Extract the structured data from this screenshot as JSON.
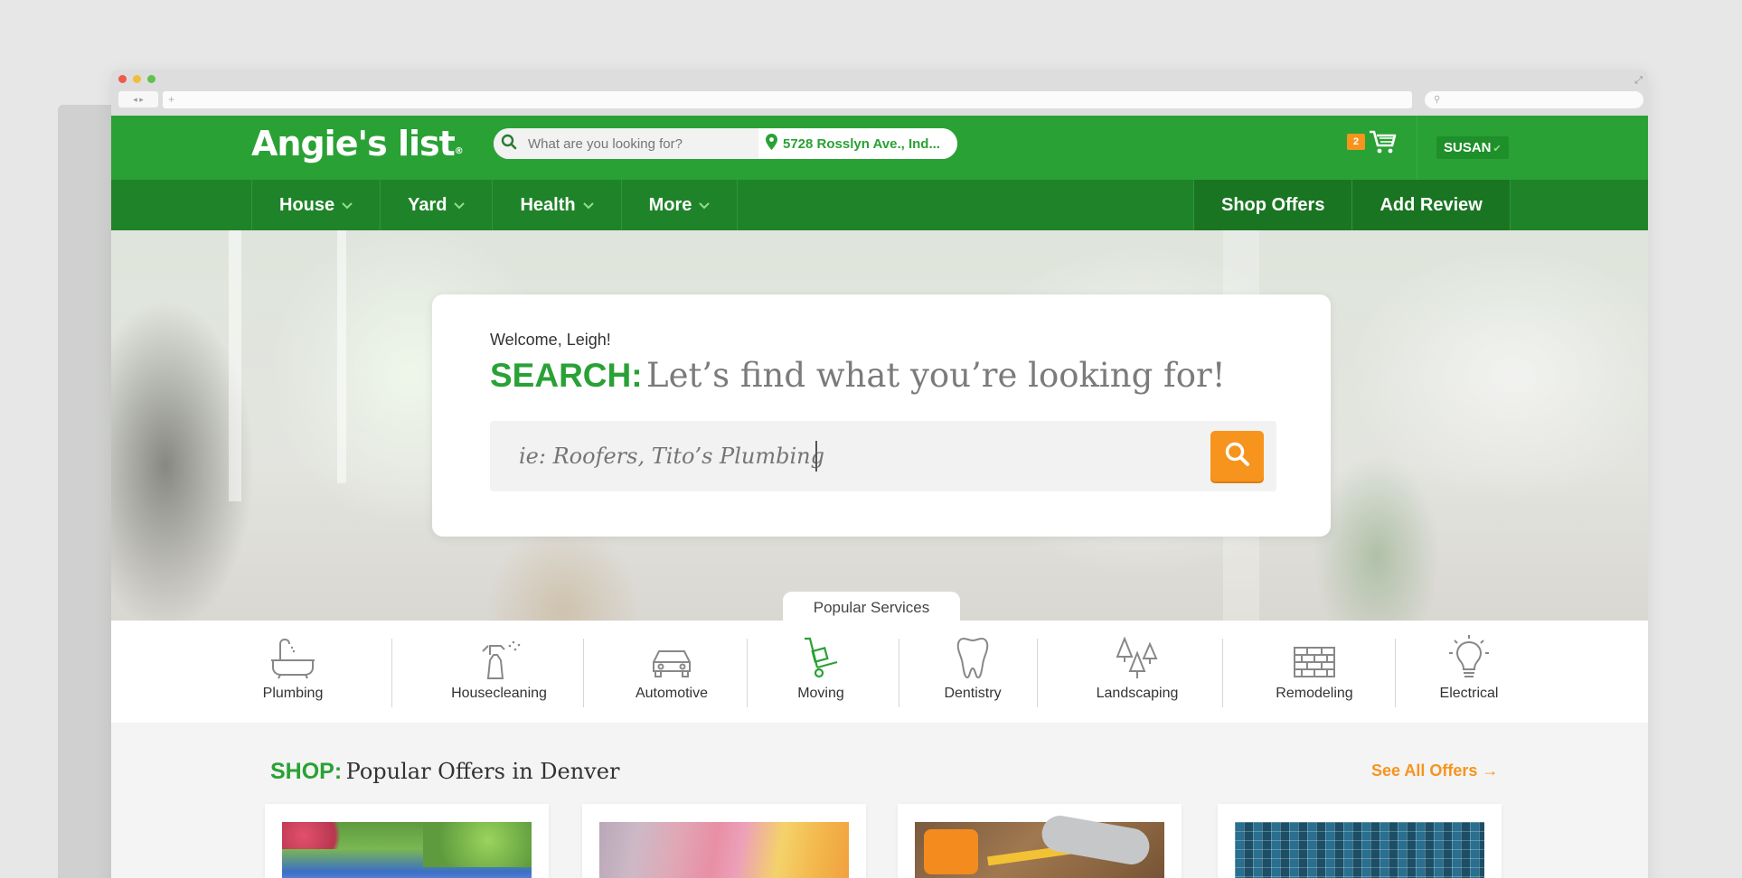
{
  "browser": {
    "nav_arrows": "◂ ▸",
    "url_placeholder": "+",
    "search_glyph": "⚲"
  },
  "header": {
    "logo_text": "Angie's list",
    "logo_mark": "®",
    "search_placeholder": "What are you looking for?",
    "location": "5728 Rosslyn Ave., Ind...",
    "cart_count": "2",
    "user_name": "SUSAN"
  },
  "nav": {
    "items": [
      {
        "label": "House"
      },
      {
        "label": "Yard"
      },
      {
        "label": "Health"
      },
      {
        "label": "More"
      }
    ],
    "shop_offers": "Shop Offers",
    "add_review": "Add Review"
  },
  "hero": {
    "welcome": "Welcome, Leigh!",
    "headline_accent": "SEARCH:",
    "headline_rest": "Let’s find what you’re looking for!",
    "search_placeholder": "ie: Roofers, Tito’s Plumbing"
  },
  "popular": {
    "tab_label": "Popular Services",
    "services": [
      {
        "label": "Plumbing",
        "icon": "bathtub-icon"
      },
      {
        "label": "Housecleaning",
        "icon": "spray-bottle-icon"
      },
      {
        "label": "Automotive",
        "icon": "car-icon"
      },
      {
        "label": "Moving",
        "icon": "hand-truck-icon"
      },
      {
        "label": "Dentistry",
        "icon": "tooth-icon"
      },
      {
        "label": "Landscaping",
        "icon": "trees-icon"
      },
      {
        "label": "Remodeling",
        "icon": "bricks-icon"
      },
      {
        "label": "Electrical",
        "icon": "lightbulb-icon"
      }
    ]
  },
  "shop": {
    "title_accent": "SHOP:",
    "title_rest": "Popular Offers in Denver",
    "see_all": "See All Offers →"
  },
  "colors": {
    "brand_green": "#2aa135",
    "nav_green": "#1f8429",
    "accent_orange": "#f7941d"
  }
}
